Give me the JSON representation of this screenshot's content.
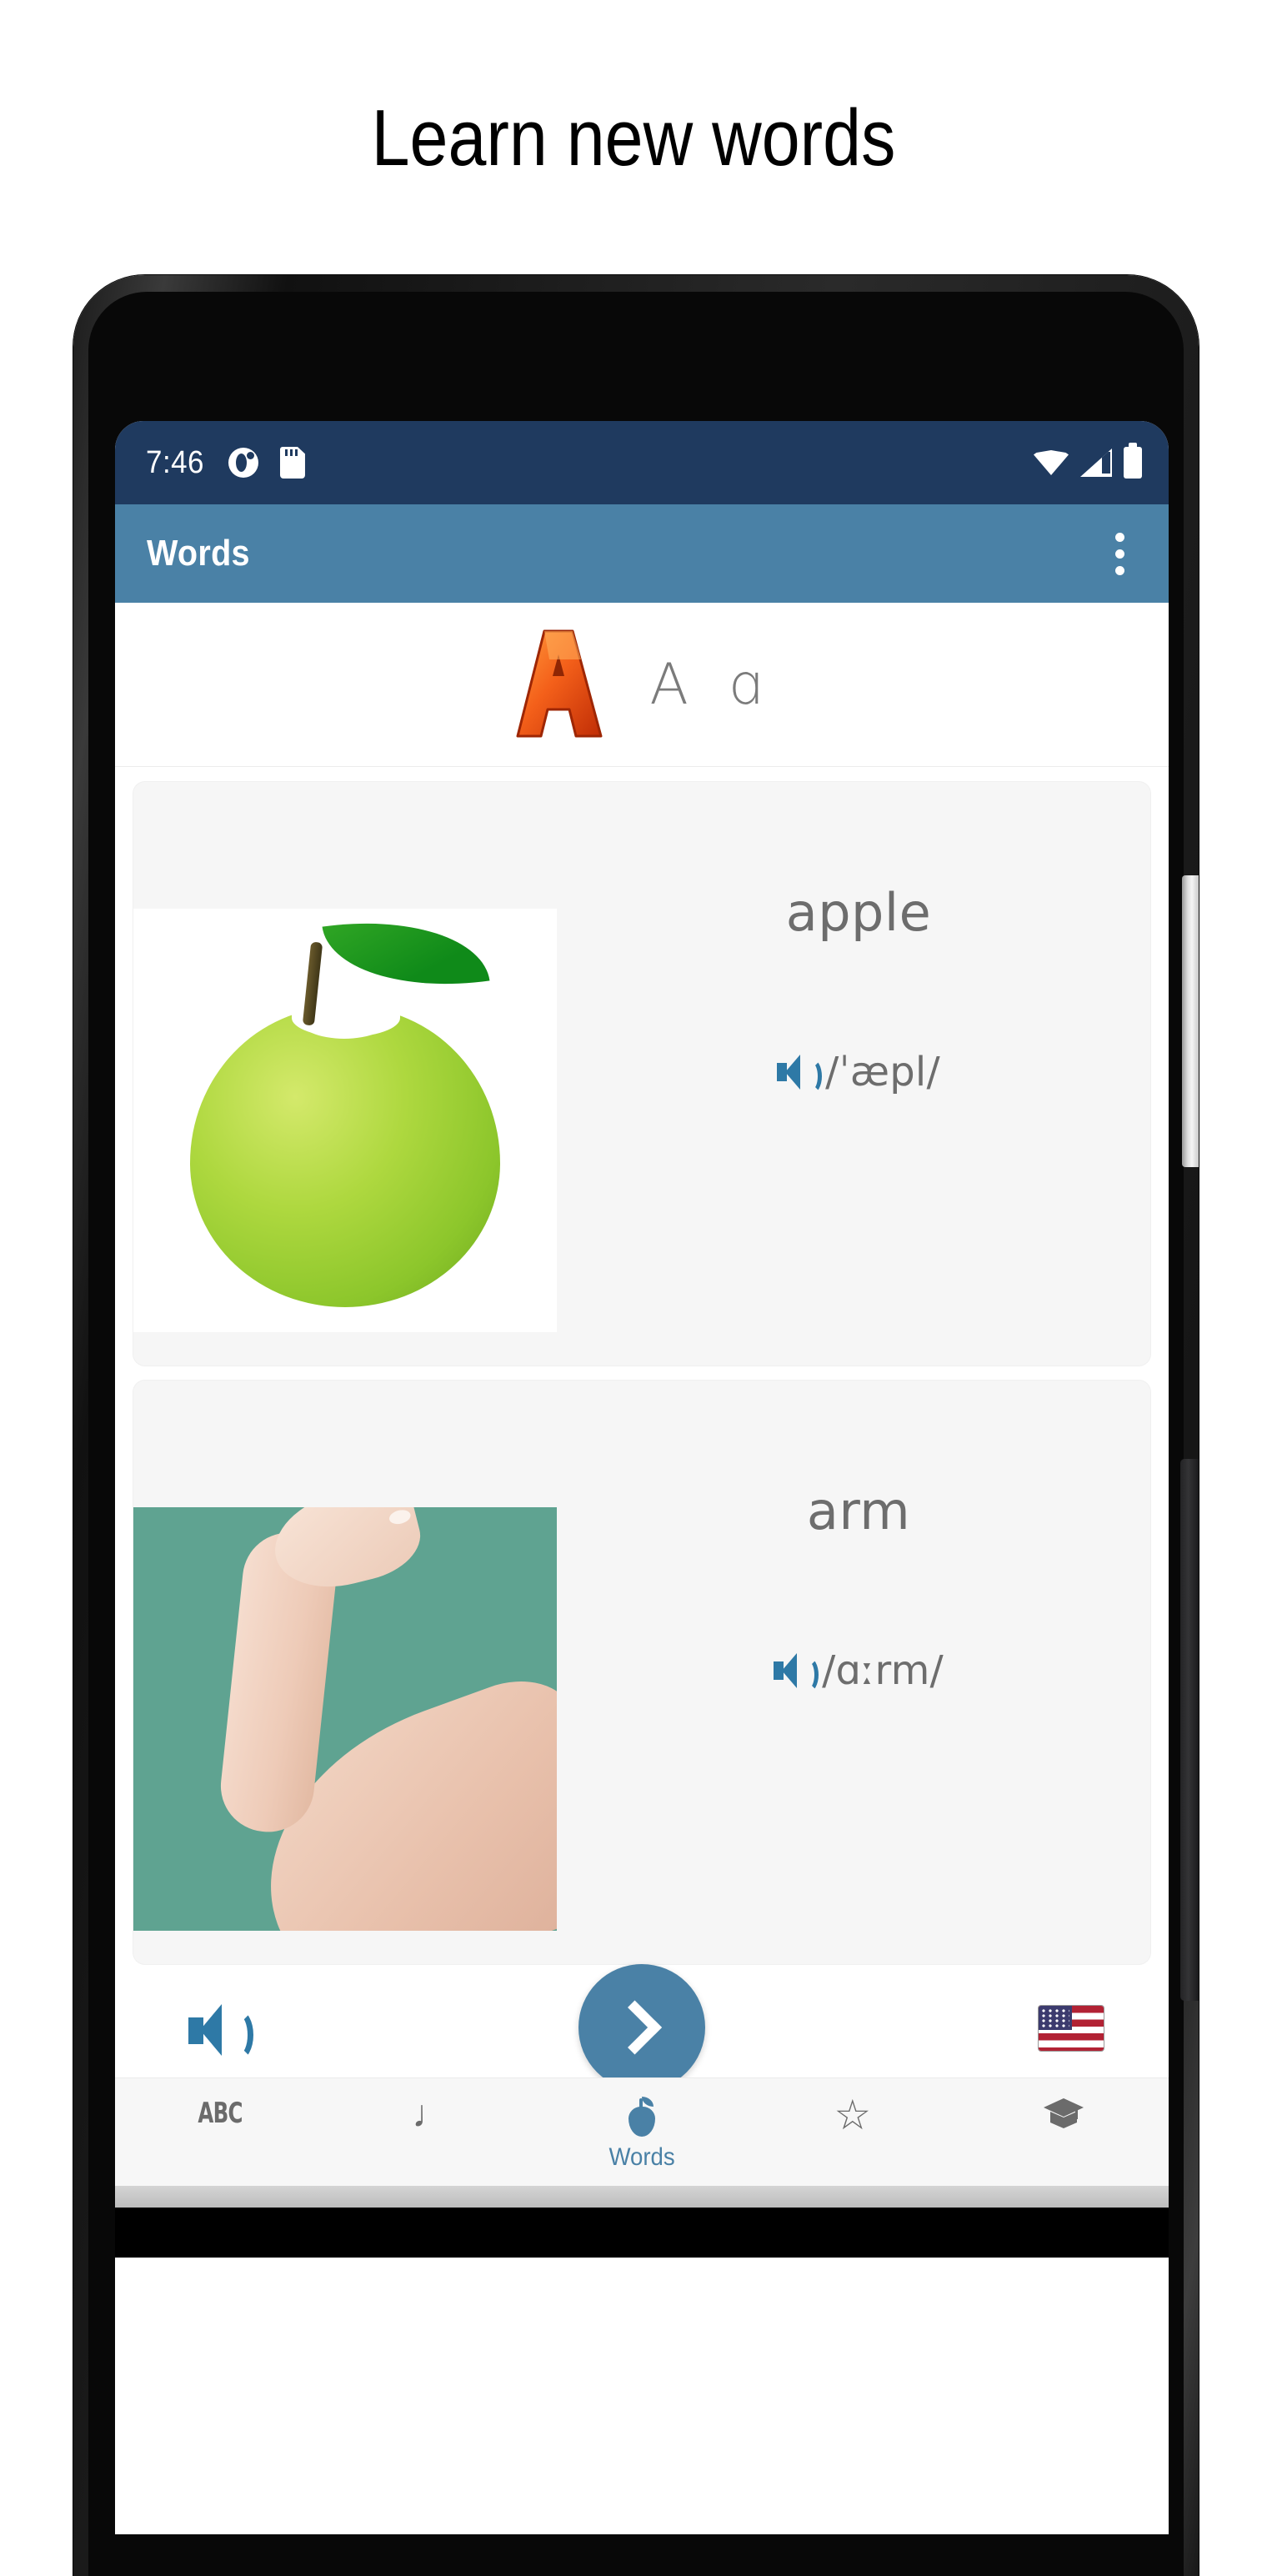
{
  "page": {
    "heading": "Learn new words"
  },
  "device": {
    "camera_icon": "camera-icon",
    "earpiece_icon": "earpiece-speaker-icon",
    "power_button": "power-button",
    "volume_button": "volume-rocker-button"
  },
  "status_bar": {
    "time": "7:46",
    "left_icons": [
      "app-notification-icon",
      "sd-card-icon"
    ],
    "right_icons": [
      "wifi-icon",
      "cellular-signal-icon",
      "battery-icon"
    ],
    "background_color": "#1f3a5f"
  },
  "app_bar": {
    "title": "Words",
    "overflow_label": "More options",
    "background_color": "#4a81a6",
    "title_color": "#ffffff"
  },
  "letter_header": {
    "letter_image_alt": "letter-A-3d-image",
    "letter_pair": "A ɑ",
    "text_color": "#7b7b7b"
  },
  "words": [
    {
      "word": "apple",
      "phonetic": "/ˈæpl/",
      "image_alt": "green-apple-photo",
      "speaker_label": "play-pronunciation"
    },
    {
      "word": "arm",
      "phonetic": "/ɑːrm/",
      "image_alt": "human-arm-photo",
      "speaker_label": "play-pronunciation"
    }
  ],
  "action_bar": {
    "speaker_label": "play-all-audio",
    "next_label": "next-page",
    "flag_label": "united-states-flag",
    "accent_color": "#4a81a6",
    "speaker_color": "#2e79a6"
  },
  "bottom_nav": {
    "active_index": 2,
    "active_color": "#4a81a6",
    "inactive_color": "#6b6b6b",
    "items": [
      {
        "icon": "abc-icon",
        "glyph": "ABC",
        "label": ""
      },
      {
        "icon": "music-note-icon",
        "glyph": "♩",
        "label": ""
      },
      {
        "icon": "apple-icon",
        "glyph": "",
        "label": "Words"
      },
      {
        "icon": "star-outline-icon",
        "glyph": "☆",
        "label": ""
      },
      {
        "icon": "graduation-cap-icon",
        "glyph": "🎓",
        "label": ""
      }
    ]
  }
}
